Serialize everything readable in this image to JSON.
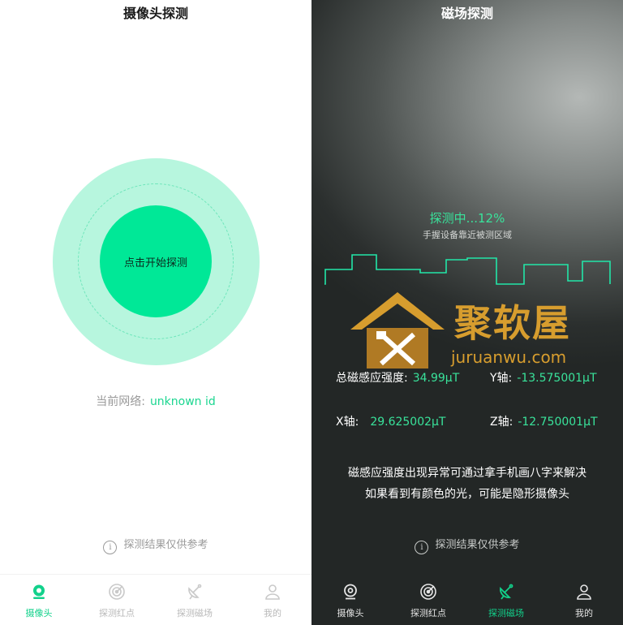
{
  "camera_screen": {
    "title": "摄像头探测",
    "start_button": "点击开始探测",
    "network_label": "当前网络:",
    "network_value": "unknown id",
    "disclaimer": "探测结果仅供参考",
    "tabs": [
      "摄像头",
      "探测红点",
      "探测磁场",
      "我的"
    ]
  },
  "magnetic_screen": {
    "title": "磁场探测",
    "progress": "探测中...12%",
    "hint": "手握设备靠近被测区域",
    "watermark": {
      "name": "聚软屋",
      "url": "juruanwu.com"
    },
    "readings": {
      "total_label": "总磁感应强度:",
      "total_value": "34.99μT",
      "y_label": "Y轴:",
      "y_value": "-13.575001μT",
      "x_label": "X轴:",
      "x_value": "29.625002μT",
      "z_label": "Z轴:",
      "z_value": "-12.750001μT"
    },
    "message_line1": "磁感应强度出现异常可通过拿手机画八字来解决",
    "message_line2": "如果看到有颜色的光，可能是隐形摄像头",
    "disclaimer": "探测结果仅供参考",
    "tabs": [
      "摄像头",
      "探测红点",
      "探测磁场",
      "我的"
    ]
  },
  "colors": {
    "accent": "#12d18b",
    "light_ring": "#b7f6de",
    "inner_circle": "#00e897",
    "watermark": "#d79d2e"
  },
  "icons": {
    "tab_camera": "camera-icon",
    "tab_infrared": "radar-icon",
    "tab_magnetic": "satellite-dish-icon",
    "tab_profile": "user-icon",
    "info": "info-icon"
  }
}
